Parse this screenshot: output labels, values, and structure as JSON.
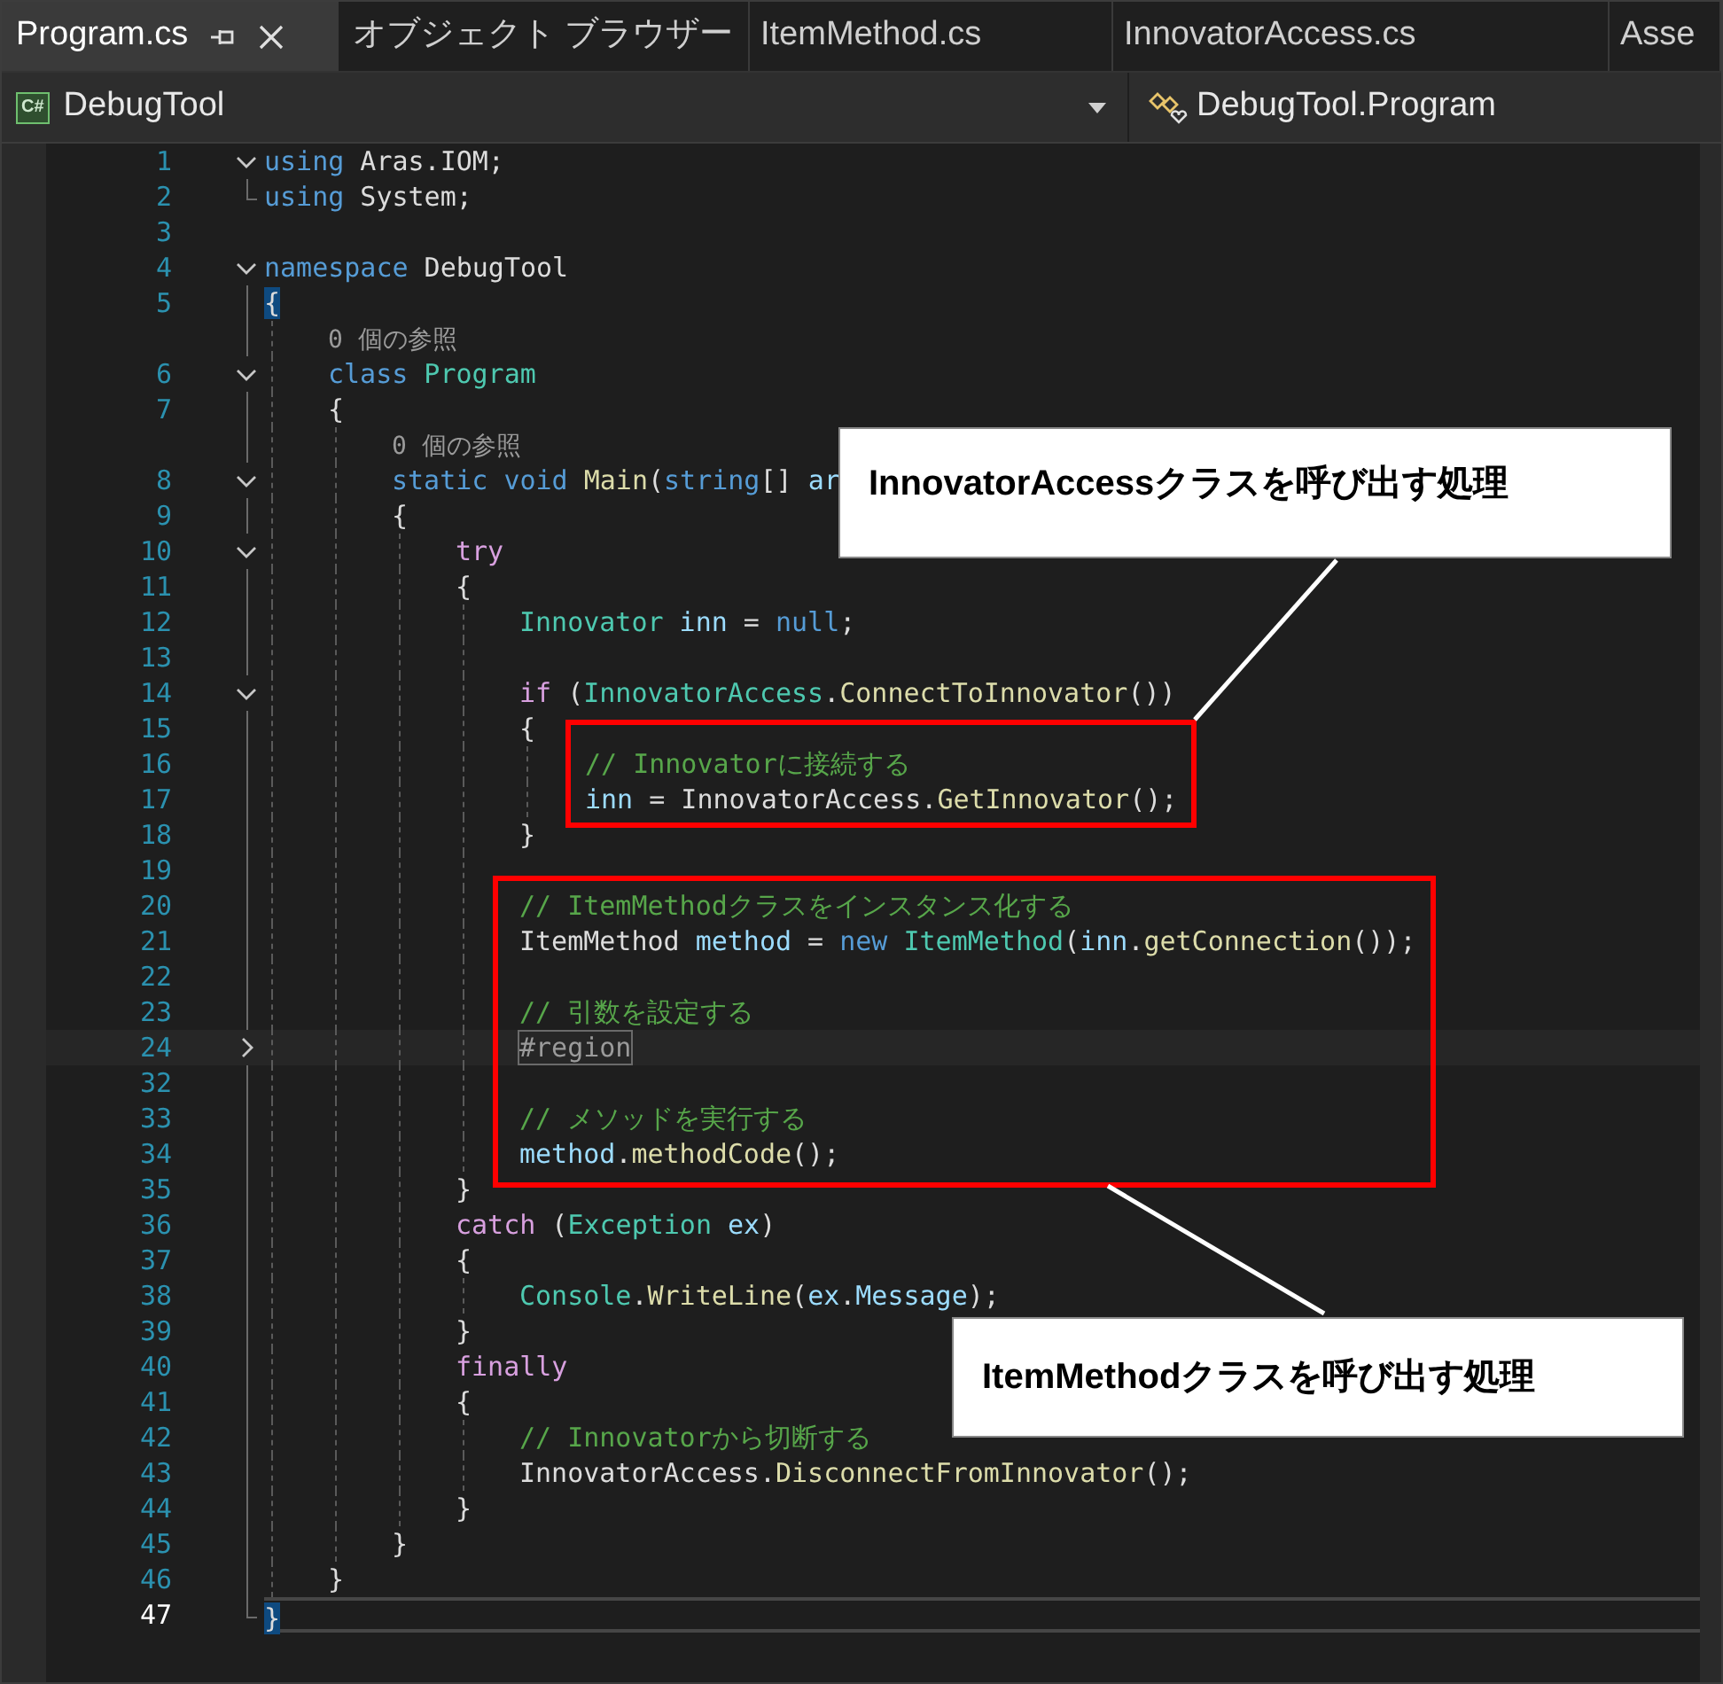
{
  "tabs": [
    {
      "label": "Program.cs",
      "selected": true,
      "pinned": true,
      "closable": true
    },
    {
      "label": "オブジェクト ブラウザー",
      "selected": false,
      "pinned": false,
      "closable": false
    },
    {
      "label": "ItemMethod.cs",
      "selected": false,
      "pinned": false,
      "closable": false
    },
    {
      "label": "InnovatorAccess.cs",
      "selected": false,
      "pinned": false,
      "closable": false
    },
    {
      "label": "Asse",
      "selected": false,
      "pinned": false,
      "closable": false
    }
  ],
  "nav_bar": {
    "project_badge": "C#",
    "project": "DebugTool",
    "type": "DebugTool.Program"
  },
  "lines": [
    {
      "kind": "code",
      "number": "1",
      "expanded": true,
      "current": false,
      "tokens": [
        {
          "text": "using",
          "kind": "kw"
        },
        {
          "text": " Aras.IOM;",
          "kind": "pl"
        }
      ]
    },
    {
      "kind": "code",
      "number": "2",
      "current": false,
      "tokens": [
        {
          "text": "using",
          "kind": "kw"
        },
        {
          "text": " System;",
          "kind": "pl"
        }
      ]
    },
    {
      "kind": "code",
      "number": "3",
      "current": false
    },
    {
      "kind": "code",
      "number": "4",
      "expanded": true,
      "current": false,
      "tokens": [
        {
          "text": "namespace",
          "kind": "kw"
        },
        {
          "text": " DebugTool",
          "kind": "pl"
        }
      ]
    },
    {
      "kind": "code",
      "number": "5",
      "current": false,
      "tokens": [
        {
          "text": "{",
          "kind": "match"
        }
      ],
      "children": [
        {
          "kind": "codelens",
          "text": "0 個の参照"
        },
        {
          "kind": "code",
          "number": "6",
          "expanded": true,
          "current": false,
          "tokens": [
            {
              "text": "class",
              "kind": "kw"
            },
            {
              "text": " Program",
              "kind": "type"
            }
          ]
        },
        {
          "kind": "code",
          "number": "7",
          "current": false,
          "tokens": [
            {
              "text": "{",
              "kind": "pl"
            }
          ],
          "children": [
            {
              "kind": "codelens",
              "text": "0 個の参照"
            },
            {
              "kind": "code",
              "number": "8",
              "expanded": true,
              "current": false,
              "tokens": [
                {
                  "text": "static void",
                  "kind": "kw"
                },
                {
                  "text": " Main",
                  "kind": "fn"
                },
                {
                  "text": "(",
                  "kind": "pl"
                },
                {
                  "text": "string",
                  "kind": "kw"
                },
                {
                  "text": "[] ",
                  "kind": "pl"
                },
                {
                  "text": "ar",
                  "kind": "var"
                }
              ]
            },
            {
              "kind": "code",
              "number": "9",
              "current": false,
              "tokens": [
                {
                  "text": "{",
                  "kind": "pl"
                }
              ],
              "children": [
                {
                  "kind": "code",
                  "number": "10",
                  "expanded": true,
                  "current": false,
                  "tokens": [
                    {
                      "text": "try",
                      "kind": "ctl"
                    }
                  ]
                },
                {
                  "kind": "code",
                  "number": "11",
                  "current": false,
                  "tokens": [
                    {
                      "text": "{",
                      "kind": "pl"
                    }
                  ],
                  "children": [
                    {
                      "kind": "code",
                      "number": "12",
                      "current": false,
                      "tokens": [
                        {
                          "text": "Innovator",
                          "kind": "type"
                        },
                        {
                          "text": " inn",
                          "kind": "var"
                        },
                        {
                          "text": " = ",
                          "kind": "pl"
                        },
                        {
                          "text": "null",
                          "kind": "kw"
                        },
                        {
                          "text": ";",
                          "kind": "pl"
                        }
                      ]
                    },
                    {
                      "kind": "code",
                      "number": "13",
                      "current": false
                    },
                    {
                      "kind": "code",
                      "number": "14",
                      "expanded": true,
                      "current": false,
                      "tokens": [
                        {
                          "text": "if",
                          "kind": "ctl"
                        },
                        {
                          "text": " (",
                          "kind": "pl"
                        },
                        {
                          "text": "InnovatorAccess",
                          "kind": "type"
                        },
                        {
                          "text": ".",
                          "kind": "pl"
                        },
                        {
                          "text": "ConnectToInnovator",
                          "kind": "fn"
                        },
                        {
                          "text": "())",
                          "kind": "pl"
                        }
                      ]
                    },
                    {
                      "kind": "code",
                      "number": "15",
                      "current": false,
                      "tokens": [
                        {
                          "text": "{",
                          "kind": "pl"
                        }
                      ],
                      "children": [
                        {
                          "kind": "code",
                          "number": "16",
                          "current": false,
                          "tokens": [
                            {
                              "text": "// Innovatorに接続する",
                              "kind": "cm"
                            }
                          ]
                        },
                        {
                          "kind": "code",
                          "number": "17",
                          "current": false,
                          "tokens": [
                            {
                              "text": "inn",
                              "kind": "var"
                            },
                            {
                              "text": " = InnovatorAccess.",
                              "kind": "pl"
                            },
                            {
                              "text": "GetInnovator",
                              "kind": "fn"
                            },
                            {
                              "text": "();",
                              "kind": "pl"
                            }
                          ]
                        }
                      ]
                    },
                    {
                      "kind": "code",
                      "number": "18",
                      "current": false,
                      "tokens": [
                        {
                          "text": "}",
                          "kind": "pl"
                        }
                      ]
                    },
                    {
                      "kind": "code",
                      "number": "19",
                      "current": false
                    },
                    {
                      "kind": "code",
                      "number": "20",
                      "current": false,
                      "tokens": [
                        {
                          "text": "// ItemMethodクラスをインスタンス化する",
                          "kind": "cm"
                        }
                      ]
                    },
                    {
                      "kind": "code",
                      "number": "21",
                      "current": false,
                      "tokens": [
                        {
                          "text": "ItemMethod",
                          "kind": "pl"
                        },
                        {
                          "text": " method",
                          "kind": "var"
                        },
                        {
                          "text": " = ",
                          "kind": "pl"
                        },
                        {
                          "text": "new",
                          "kind": "kw"
                        },
                        {
                          "text": " ItemMethod",
                          "kind": "type"
                        },
                        {
                          "text": "(",
                          "kind": "pl"
                        },
                        {
                          "text": "inn",
                          "kind": "var"
                        },
                        {
                          "text": ".",
                          "kind": "pl"
                        },
                        {
                          "text": "getConnection",
                          "kind": "fn"
                        },
                        {
                          "text": "());",
                          "kind": "pl"
                        }
                      ]
                    },
                    {
                      "kind": "code",
                      "number": "22",
                      "current": false
                    },
                    {
                      "kind": "code",
                      "number": "23",
                      "current": false,
                      "tokens": [
                        {
                          "text": "// 引数を設定する",
                          "kind": "cm"
                        }
                      ]
                    },
                    {
                      "kind": "code",
                      "number": "24",
                      "expanded": false,
                      "current": false,
                      "tokens": [
                        {
                          "text": "#region",
                          "kind": "region"
                        }
                      ]
                    },
                    {
                      "kind": "code",
                      "number": "32",
                      "current": false
                    },
                    {
                      "kind": "code",
                      "number": "33",
                      "current": false,
                      "tokens": [
                        {
                          "text": "// メソッドを実行する",
                          "kind": "cm"
                        }
                      ]
                    },
                    {
                      "kind": "code",
                      "number": "34",
                      "current": false,
                      "tokens": [
                        {
                          "text": "method",
                          "kind": "var"
                        },
                        {
                          "text": ".",
                          "kind": "pl"
                        },
                        {
                          "text": "methodCode",
                          "kind": "fn"
                        },
                        {
                          "text": "();",
                          "kind": "pl"
                        }
                      ]
                    }
                  ]
                },
                {
                  "kind": "code",
                  "number": "35",
                  "current": false,
                  "tokens": [
                    {
                      "text": "}",
                      "kind": "pl"
                    }
                  ]
                },
                {
                  "kind": "code",
                  "number": "36",
                  "current": false,
                  "tokens": [
                    {
                      "text": "catch",
                      "kind": "ctl"
                    },
                    {
                      "text": " (",
                      "kind": "pl"
                    },
                    {
                      "text": "Exception",
                      "kind": "type"
                    },
                    {
                      "text": " ex",
                      "kind": "var"
                    },
                    {
                      "text": ")",
                      "kind": "pl"
                    }
                  ]
                },
                {
                  "kind": "code",
                  "number": "37",
                  "current": false,
                  "tokens": [
                    {
                      "text": "{",
                      "kind": "pl"
                    }
                  ],
                  "children": [
                    {
                      "kind": "code",
                      "number": "38",
                      "current": false,
                      "tokens": [
                        {
                          "text": "Console",
                          "kind": "type"
                        },
                        {
                          "text": ".",
                          "kind": "pl"
                        },
                        {
                          "text": "WriteLine",
                          "kind": "fn"
                        },
                        {
                          "text": "(",
                          "kind": "pl"
                        },
                        {
                          "text": "ex",
                          "kind": "var"
                        },
                        {
                          "text": ".",
                          "kind": "pl"
                        },
                        {
                          "text": "Message",
                          "kind": "var"
                        },
                        {
                          "text": ");",
                          "kind": "pl"
                        }
                      ]
                    }
                  ]
                },
                {
                  "kind": "code",
                  "number": "39",
                  "current": false,
                  "tokens": [
                    {
                      "text": "}",
                      "kind": "pl"
                    }
                  ]
                },
                {
                  "kind": "code",
                  "number": "40",
                  "current": false,
                  "tokens": [
                    {
                      "text": "finally",
                      "kind": "ctl"
                    }
                  ]
                },
                {
                  "kind": "code",
                  "number": "41",
                  "current": false,
                  "tokens": [
                    {
                      "text": "{",
                      "kind": "pl"
                    }
                  ],
                  "children": [
                    {
                      "kind": "code",
                      "number": "42",
                      "current": false,
                      "tokens": [
                        {
                          "text": "// Innovatorから切断する",
                          "kind": "cm"
                        }
                      ]
                    },
                    {
                      "kind": "code",
                      "number": "43",
                      "current": false,
                      "tokens": [
                        {
                          "text": "InnovatorAccess.",
                          "kind": "pl"
                        },
                        {
                          "text": "DisconnectFromInnovator",
                          "kind": "fn"
                        },
                        {
                          "text": "();",
                          "kind": "pl"
                        }
                      ]
                    }
                  ]
                },
                {
                  "kind": "code",
                  "number": "44",
                  "current": false,
                  "tokens": [
                    {
                      "text": "}",
                      "kind": "pl"
                    }
                  ]
                }
              ]
            },
            {
              "kind": "code",
              "number": "45",
              "current": false,
              "tokens": [
                {
                  "text": "}",
                  "kind": "pl"
                }
              ]
            }
          ]
        },
        {
          "kind": "code",
          "number": "46",
          "current": false,
          "tokens": [
            {
              "text": "}",
              "kind": "pl"
            }
          ]
        }
      ]
    },
    {
      "kind": "code",
      "number": "47",
      "current": true,
      "tokens": [
        {
          "text": "}",
          "kind": "match"
        }
      ]
    }
  ],
  "callouts": [
    {
      "text": "InnovatorAccessクラスを呼び出す処理"
    },
    {
      "text": "ItemMethodクラスを呼び出す処理"
    }
  ]
}
